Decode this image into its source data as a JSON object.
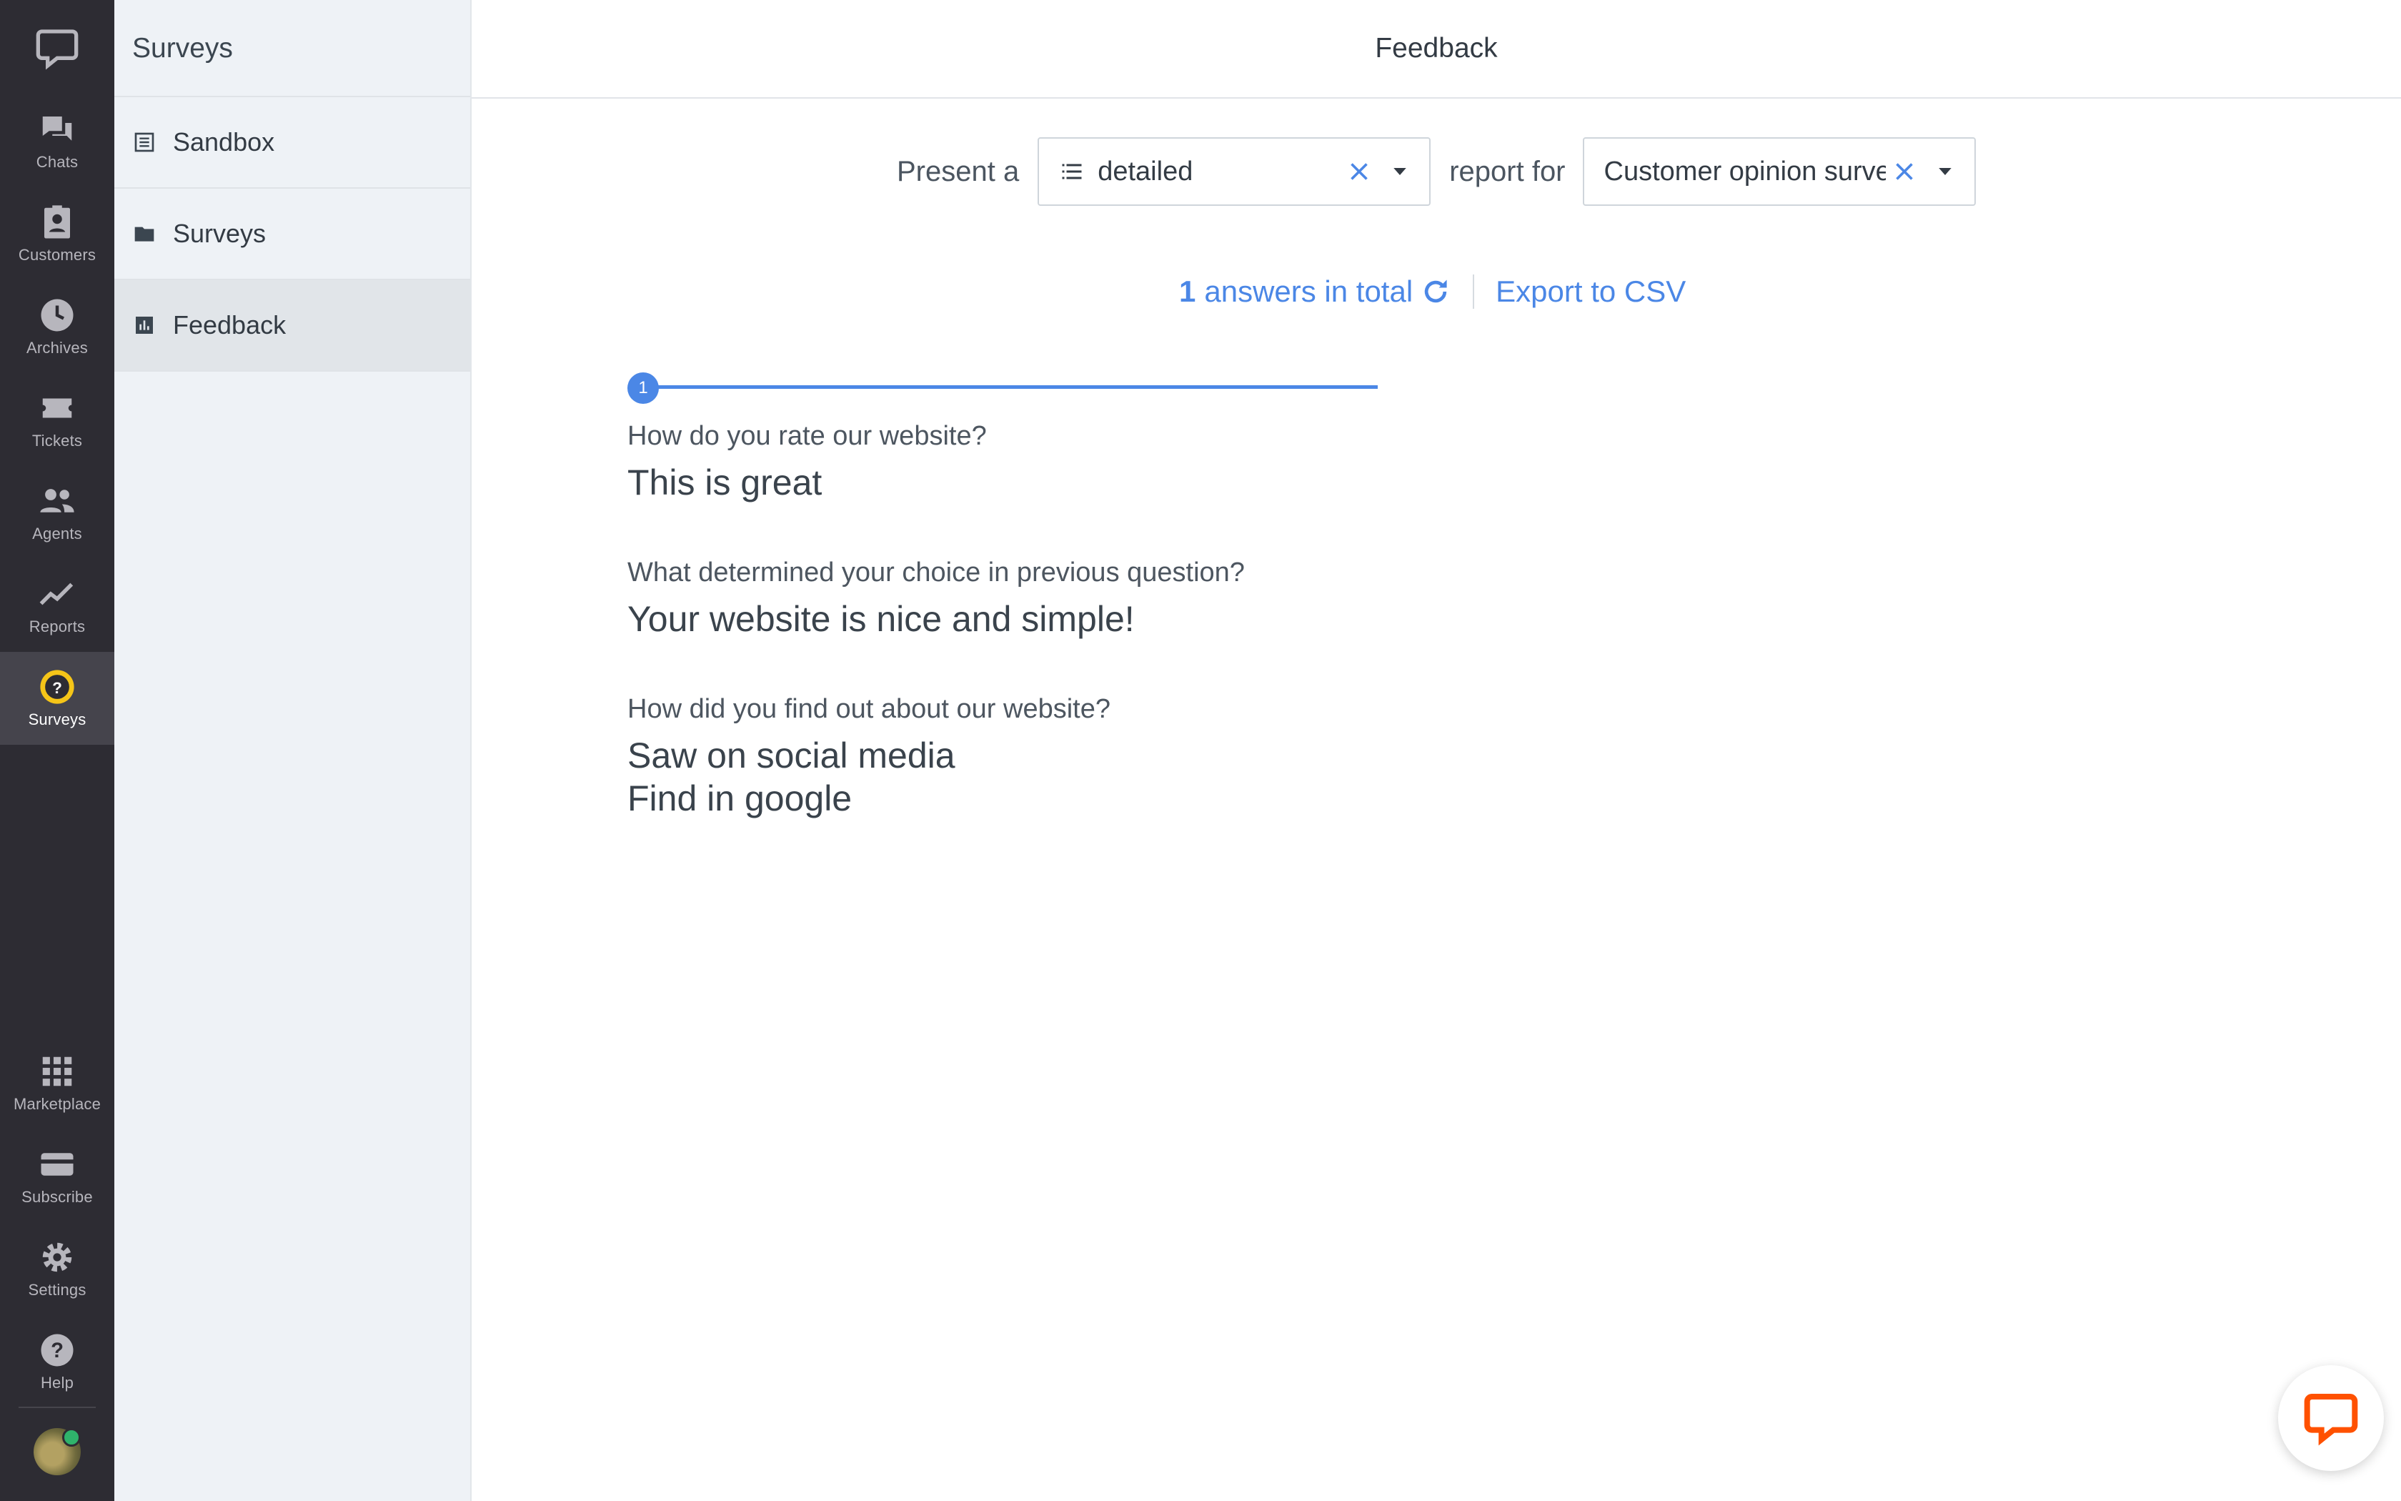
{
  "rail": {
    "items": [
      {
        "label": "Chats",
        "icon": "chat-bubbles-icon"
      },
      {
        "label": "Customers",
        "icon": "contact-card-icon"
      },
      {
        "label": "Archives",
        "icon": "clock-icon"
      },
      {
        "label": "Tickets",
        "icon": "ticket-icon"
      },
      {
        "label": "Agents",
        "icon": "people-icon"
      },
      {
        "label": "Reports",
        "icon": "line-chart-icon"
      },
      {
        "label": "Surveys",
        "icon": "question-badge-icon"
      },
      {
        "label": "Marketplace",
        "icon": "grid-icon"
      },
      {
        "label": "Subscribe",
        "icon": "card-icon"
      },
      {
        "label": "Settings",
        "icon": "gear-icon"
      },
      {
        "label": "Help",
        "icon": "help-icon"
      }
    ],
    "active": "Surveys",
    "accent": "#f5c518"
  },
  "subnav": {
    "title": "Surveys",
    "items": [
      {
        "label": "Sandbox",
        "icon": "list-doc-icon"
      },
      {
        "label": "Surveys",
        "icon": "folder-icon"
      },
      {
        "label": "Feedback",
        "icon": "bar-chart-icon"
      }
    ],
    "active": "Feedback"
  },
  "main": {
    "title": "Feedback",
    "controls": {
      "prefix": "Present a",
      "report_type": "detailed",
      "middle": "report for",
      "survey": "Customer opinion survey"
    },
    "stats": {
      "count": "1",
      "label": "answers in total",
      "export": "Export to CSV"
    },
    "progress": {
      "current": "1"
    },
    "questions": [
      {
        "question": "How do you rate our website?",
        "answers": [
          "This is great"
        ]
      },
      {
        "question": "What determined your choice in previous question?",
        "answers": [
          "Your website is nice and simple!"
        ]
      },
      {
        "question": "How did you find out about our website?",
        "answers": [
          "Saw on social media",
          "Find in google"
        ]
      }
    ]
  },
  "colors": {
    "rail_bg": "#2d2c33",
    "subnav_bg": "#eef2f6",
    "link": "#4b87e6",
    "chat_widget": "#ff5100"
  }
}
